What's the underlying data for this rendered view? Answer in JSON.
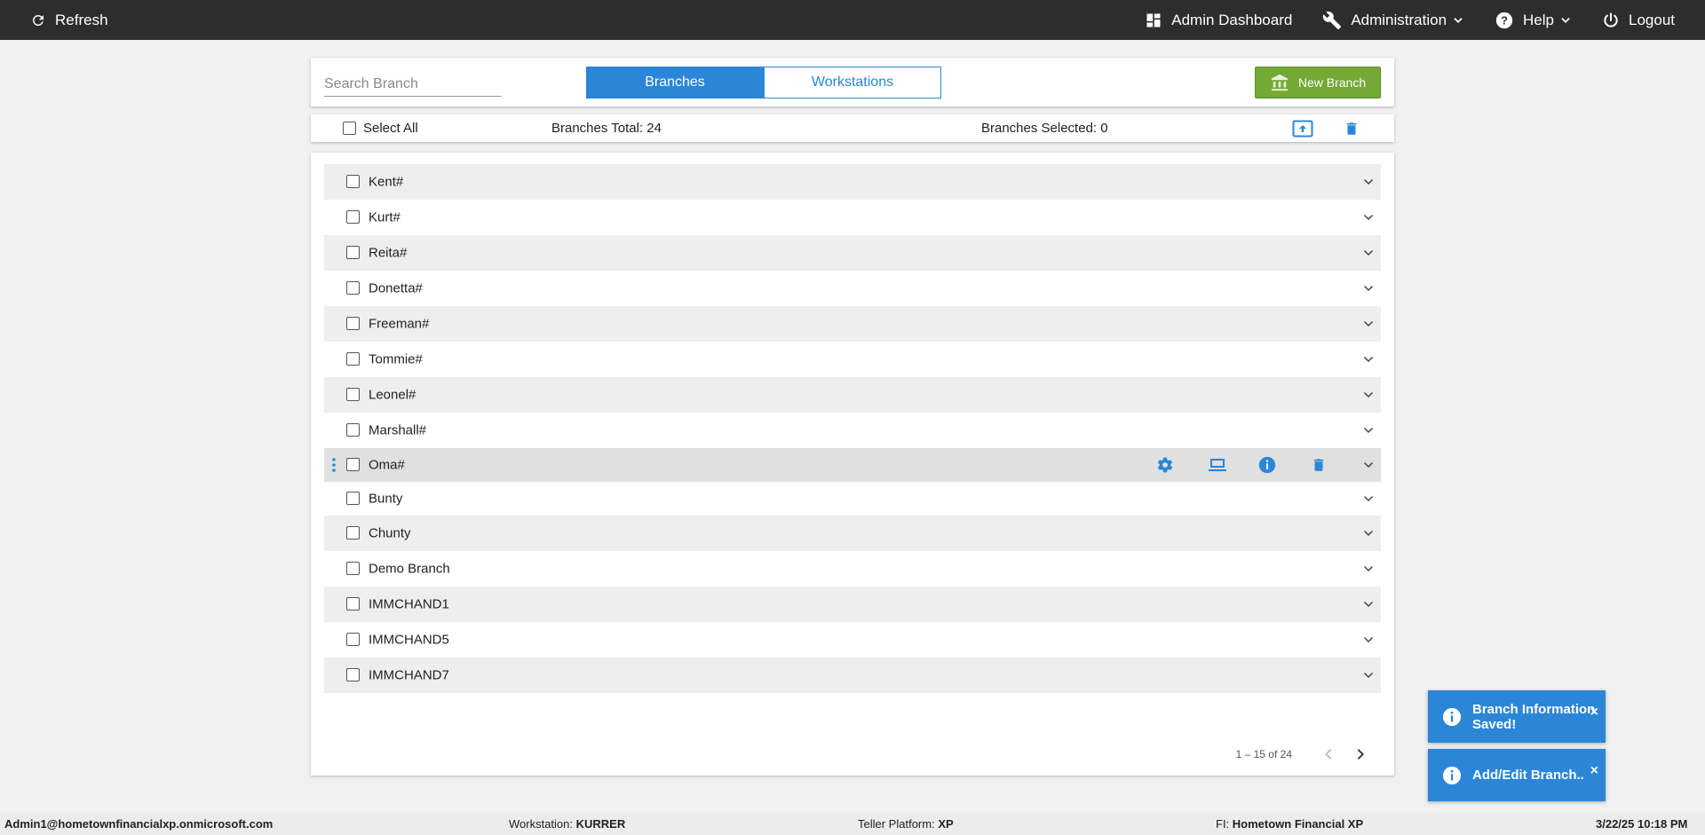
{
  "topbar": {
    "refresh_label": "Refresh",
    "admin_dashboard_label": "Admin Dashboard",
    "administration_label": "Administration",
    "help_label": "Help",
    "logout_label": "Logout"
  },
  "toolbar": {
    "search_placeholder": "Search Branch",
    "tabs": [
      {
        "label": "Branches",
        "active": true
      },
      {
        "label": "Workstations",
        "active": false
      }
    ],
    "new_branch_label": "New Branch",
    "select_all_label": "Select All",
    "branches_total_label": "Branches Total: 24",
    "branches_selected_label": "Branches Selected: 0"
  },
  "branches": [
    {
      "name": "Kent#"
    },
    {
      "name": "Kurt#"
    },
    {
      "name": "Reita#"
    },
    {
      "name": "Donetta#"
    },
    {
      "name": "Freeman#"
    },
    {
      "name": "Tommie#"
    },
    {
      "name": "Leonel#"
    },
    {
      "name": "Marshall#"
    },
    {
      "name": "Oma#"
    },
    {
      "name": "Bunty"
    },
    {
      "name": "Chunty"
    },
    {
      "name": "Demo Branch"
    },
    {
      "name": "IMMCHAND1"
    },
    {
      "name": "IMMCHAND5"
    },
    {
      "name": "IMMCHAND7"
    }
  ],
  "pagination": {
    "range_label": "1 – 15 of 24"
  },
  "toasts": [
    {
      "message": "Branch Information Saved!",
      "close": "×"
    },
    {
      "message": "Add/Edit Branch..",
      "close": "×"
    }
  ],
  "status": {
    "user": "Admin1@hometownfinancialxp.onmicrosoft.com",
    "workstation_label": "Workstation: ",
    "workstation_value": "KURRER",
    "teller_label": "Teller Platform: ",
    "teller_value": "XP",
    "fi_label": "FI: ",
    "fi_value": "Hometown Financial XP",
    "datetime": "3/22/25 10:18 PM"
  },
  "colors": {
    "accent": "#2b86d8",
    "new_branch": "#74a936",
    "topbar": "#2d2d2d"
  }
}
